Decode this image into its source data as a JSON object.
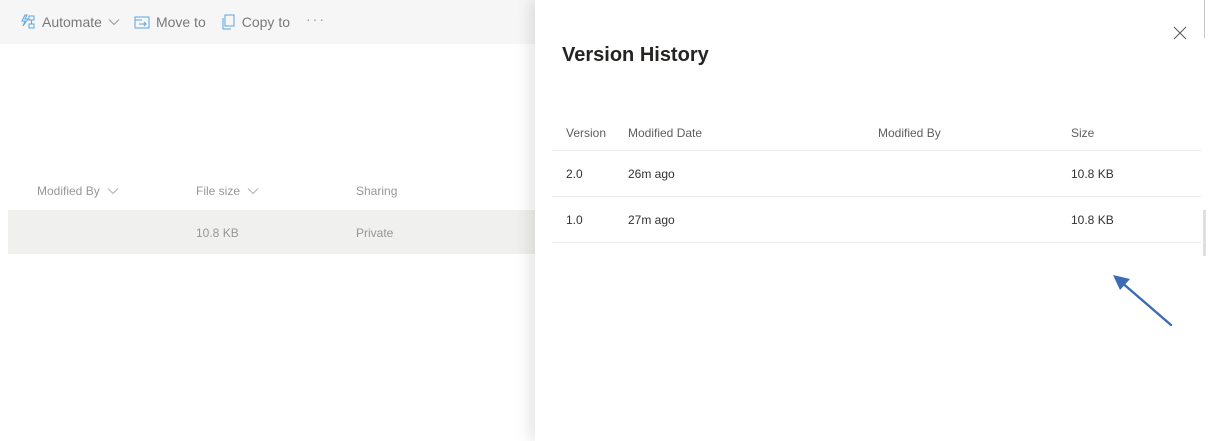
{
  "toolbar": {
    "automate_label": "Automate",
    "move_to_label": "Move to",
    "copy_to_label": "Copy to",
    "more_label": "···"
  },
  "library": {
    "columns": {
      "modified_by": "Modified By",
      "file_size": "File size",
      "sharing": "Sharing"
    },
    "rows": [
      {
        "modified_by": "",
        "file_size": "10.8 KB",
        "sharing": "Private"
      }
    ]
  },
  "panel": {
    "title": "Version History",
    "columns": {
      "version": "Version",
      "modified_date": "Modified Date",
      "modified_by": "Modified By",
      "size": "Size"
    },
    "rows": [
      {
        "version": "2.0",
        "modified_date": "26m ago",
        "modified_by": "",
        "size": "10.8 KB"
      },
      {
        "version": "1.0",
        "modified_date": "27m ago",
        "modified_by": "",
        "size": "10.8 KB"
      }
    ]
  },
  "colors": {
    "toolbar_bg": "#f3f2f1",
    "selected_row_bg": "#e9e8e7",
    "icon_blue": "#0078d4",
    "annotation_arrow": "#3b6bb5"
  },
  "icons": {
    "automate": "flow-icon",
    "move_to": "move-to-icon",
    "copy_to": "copy-icon",
    "close": "close-icon"
  }
}
